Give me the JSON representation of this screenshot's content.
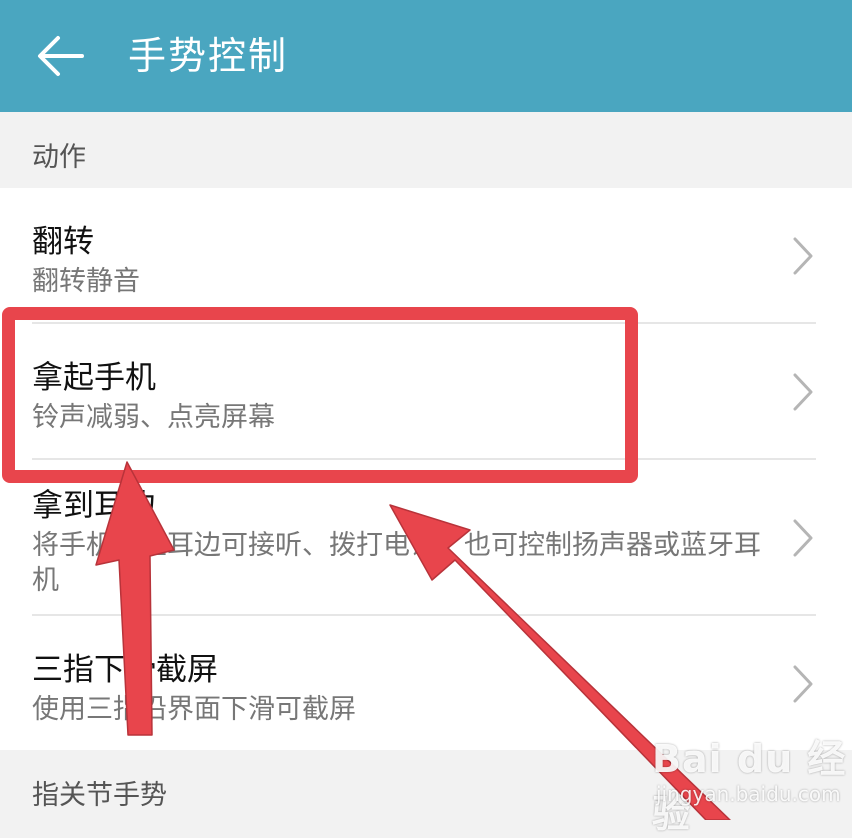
{
  "header": {
    "title": "手势控制",
    "back_icon": "back-arrow-icon"
  },
  "sections": [
    {
      "label": "动作"
    },
    {
      "label": "指关节手势"
    }
  ],
  "items": [
    {
      "title": "翻转",
      "subtitle": "翻转静音"
    },
    {
      "title": "拿起手机",
      "subtitle": "铃声减弱、点亮屏幕"
    },
    {
      "title": "拿到耳边",
      "subtitle": "将手机靠至耳边可接听、拨打电话，也可控制扬声器或蓝牙耳机"
    },
    {
      "title": "三指下滑截屏",
      "subtitle": "使用三指沿界面下滑可截屏"
    }
  ],
  "annotation": {
    "highlight_color": "#e8454c",
    "arrow_color": "#e8454c"
  },
  "watermark": {
    "logo": "Bai du 经验",
    "url": "jingyan.baidu.com"
  },
  "colors": {
    "appbar": "#4aa6c0",
    "background": "#f2f2f2",
    "card": "#ffffff"
  }
}
